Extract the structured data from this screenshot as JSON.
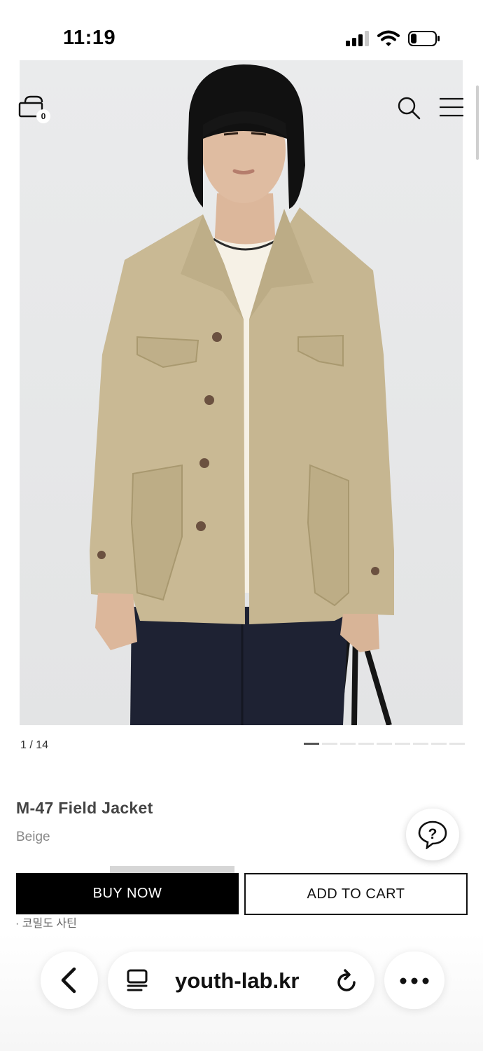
{
  "status_bar": {
    "time": "11:19"
  },
  "header": {
    "cart_count": "0"
  },
  "gallery": {
    "counter": "1 / 14",
    "total_images": 14,
    "current_index": 1
  },
  "product": {
    "name": "M-47 Field Jacket",
    "color": "Beige",
    "note_peek": "· 코밀도 사틴"
  },
  "actions": {
    "buy_now": "BUY NOW",
    "add_to_cart": "ADD TO CART"
  },
  "browser": {
    "url": "youth-lab.kr"
  },
  "icons": {
    "cart": "shopping-bag-icon",
    "search": "search-icon",
    "menu": "hamburger-menu-icon",
    "help": "question-chat-icon",
    "back": "chevron-left-icon",
    "reader": "reader-mode-icon",
    "reload": "reload-icon",
    "more": "more-dots-icon"
  },
  "colors": {
    "primary_button": "#000000",
    "secondary_border": "#111111",
    "jacket": "#c9b994",
    "background_photo": "#e6e7e8"
  }
}
